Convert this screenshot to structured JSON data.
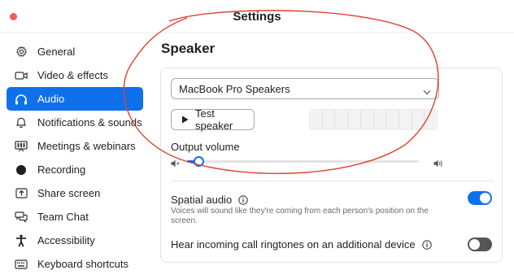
{
  "window": {
    "title": "Settings"
  },
  "sidebar": {
    "items": [
      {
        "label": "General",
        "icon": "gear-icon",
        "active": false
      },
      {
        "label": "Video & effects",
        "icon": "video-camera-icon",
        "active": false
      },
      {
        "label": "Audio",
        "icon": "headphones-icon",
        "active": true
      },
      {
        "label": "Notifications & sounds",
        "icon": "bell-icon",
        "active": false
      },
      {
        "label": "Meetings & webinars",
        "icon": "projector-icon",
        "active": false
      },
      {
        "label": "Recording",
        "icon": "record-icon",
        "active": false
      },
      {
        "label": "Share screen",
        "icon": "share-screen-icon",
        "active": false
      },
      {
        "label": "Team Chat",
        "icon": "chat-icon",
        "active": false
      },
      {
        "label": "Accessibility",
        "icon": "accessibility-icon",
        "active": false
      },
      {
        "label": "Keyboard shortcuts",
        "icon": "keyboard-icon",
        "active": false
      }
    ]
  },
  "speaker": {
    "section_title": "Speaker",
    "device_select": {
      "selected": "MacBook Pro Speakers",
      "icon": "chevron-down-icon"
    },
    "test_button_label": "Test speaker",
    "level_meter_segments": 10,
    "output_volume_label": "Output volume",
    "output_volume_fraction": 0.05
  },
  "options": {
    "spatial_audio": {
      "label": "Spatial audio",
      "description": "Voices will sound like they're coming from each person's position on the screen.",
      "enabled": true
    },
    "ringtones": {
      "label": "Hear incoming call ringtones on an additional device",
      "enabled": false
    }
  },
  "colors": {
    "accent": "#0e71eb",
    "annotation": "#e0402e",
    "toggle_off": "#555555",
    "close_button": "#ee5d5a"
  }
}
